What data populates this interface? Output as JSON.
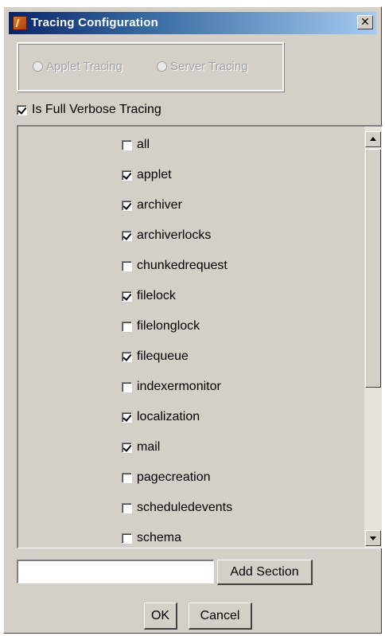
{
  "window": {
    "title": "Tracing Configuration",
    "close_glyph": "✕"
  },
  "mode": {
    "options": [
      {
        "label": "Applet Tracing",
        "selected": false,
        "enabled": false
      },
      {
        "label": "Server Tracing",
        "selected": false,
        "enabled": false
      }
    ]
  },
  "verbose": {
    "label": "Is Full Verbose Tracing",
    "checked": true
  },
  "sections": {
    "items": [
      {
        "label": "all",
        "checked": false
      },
      {
        "label": "applet",
        "checked": true
      },
      {
        "label": "archiver",
        "checked": true
      },
      {
        "label": "archiverlocks",
        "checked": true
      },
      {
        "label": "chunkedrequest",
        "checked": false
      },
      {
        "label": "filelock",
        "checked": true
      },
      {
        "label": "filelonglock",
        "checked": false
      },
      {
        "label": "filequeue",
        "checked": true
      },
      {
        "label": "indexermonitor",
        "checked": false
      },
      {
        "label": "localization",
        "checked": true
      },
      {
        "label": "mail",
        "checked": true
      },
      {
        "label": "pagecreation",
        "checked": false
      },
      {
        "label": "scheduledevents",
        "checked": false
      },
      {
        "label": "schema",
        "checked": false
      }
    ]
  },
  "add_section": {
    "input_value": "",
    "input_placeholder": "",
    "button_label": "Add Section"
  },
  "footer": {
    "ok_label": "OK",
    "cancel_label": "Cancel"
  },
  "icons": {
    "app": "tracing-app-icon",
    "close": "close-icon",
    "scroll_up": "arrow-up-icon",
    "scroll_down": "arrow-down-icon"
  }
}
